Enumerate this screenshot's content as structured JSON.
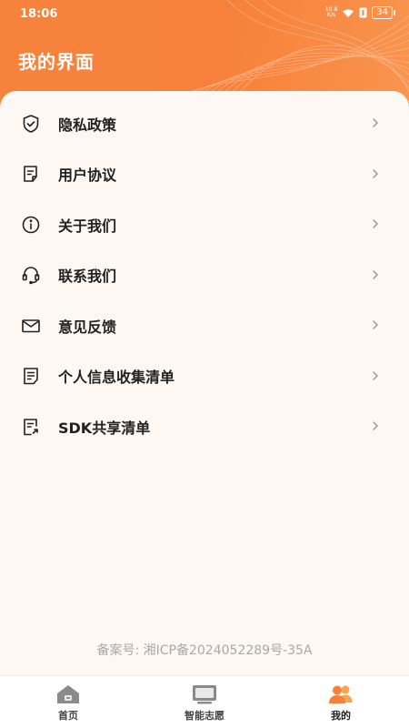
{
  "status_bar": {
    "time": "18:06",
    "net_speed_value": "10.8",
    "net_speed_unit": "K/s",
    "battery": "34"
  },
  "header": {
    "title": "我的界面"
  },
  "menu": [
    {
      "label": "隐私政策",
      "icon": "shield-check-icon"
    },
    {
      "label": "用户协议",
      "icon": "document-edit-icon"
    },
    {
      "label": "关于我们",
      "icon": "info-circle-icon"
    },
    {
      "label": "联系我们",
      "icon": "headset-icon"
    },
    {
      "label": "意见反馈",
      "icon": "mail-icon"
    },
    {
      "label": "个人信息收集清单",
      "icon": "list-document-icon"
    },
    {
      "label": "SDK共享清单",
      "icon": "share-document-icon"
    }
  ],
  "footer": {
    "icp": "备案号: 湘ICP备2024052289号-35A"
  },
  "tabbar": {
    "tabs": [
      {
        "label": "首页",
        "icon": "home-icon"
      },
      {
        "label": "智能志愿",
        "icon": "monitor-icon"
      },
      {
        "label": "我的",
        "icon": "users-icon"
      }
    ],
    "active_index": 2,
    "active_color": "#f7813a"
  },
  "colors": {
    "accent": "#f7813a",
    "background": "#fdf8f4"
  }
}
